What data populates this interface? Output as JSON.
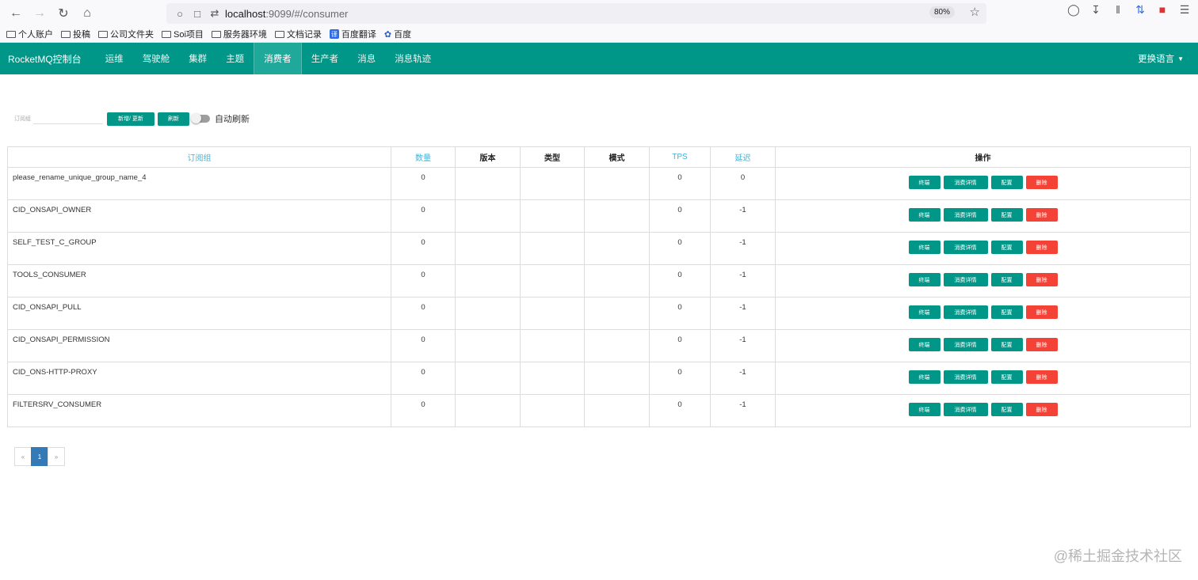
{
  "browser": {
    "url_host": "localhost",
    "url_path": ":9099/#/consumer",
    "zoom": "80%",
    "bookmarks": [
      "个人账户",
      "投稿",
      "公司文件夹",
      "Soi项目",
      "服务器环境",
      "文档记录",
      "百度翻译",
      "百度"
    ]
  },
  "navbar": {
    "brand": "RocketMQ控制台",
    "items": [
      "运维",
      "驾驶舱",
      "集群",
      "主题",
      "消费者",
      "生产者",
      "消息",
      "消息轨迹"
    ],
    "active": "消费者",
    "language": "更换语言"
  },
  "toolbar": {
    "search_label": "订阅组",
    "search_value": "",
    "add_update_label": "新增/ 更新",
    "refresh_label": "刷新",
    "auto_refresh_label": "自动刷新",
    "auto_refresh_on": false
  },
  "table": {
    "headers": [
      "订阅组",
      "数量",
      "版本",
      "类型",
      "模式",
      "TPS",
      "延迟",
      "操作"
    ],
    "sortable": [
      true,
      true,
      false,
      false,
      false,
      true,
      true,
      false
    ],
    "rows": [
      {
        "group": "please_rename_unique_group_name_4",
        "count": "0",
        "version": "",
        "type": "",
        "mode": "",
        "tps": "0",
        "delay": "0"
      },
      {
        "group": "CID_ONSAPI_OWNER",
        "count": "0",
        "version": "",
        "type": "",
        "mode": "",
        "tps": "0",
        "delay": "-1"
      },
      {
        "group": "SELF_TEST_C_GROUP",
        "count": "0",
        "version": "",
        "type": "",
        "mode": "",
        "tps": "0",
        "delay": "-1"
      },
      {
        "group": "TOOLS_CONSUMER",
        "count": "0",
        "version": "",
        "type": "",
        "mode": "",
        "tps": "0",
        "delay": "-1"
      },
      {
        "group": "CID_ONSAPI_PULL",
        "count": "0",
        "version": "",
        "type": "",
        "mode": "",
        "tps": "0",
        "delay": "-1"
      },
      {
        "group": "CID_ONSAPI_PERMISSION",
        "count": "0",
        "version": "",
        "type": "",
        "mode": "",
        "tps": "0",
        "delay": "-1"
      },
      {
        "group": "CID_ONS-HTTP-PROXY",
        "count": "0",
        "version": "",
        "type": "",
        "mode": "",
        "tps": "0",
        "delay": "-1"
      },
      {
        "group": "FILTERSRV_CONSUMER",
        "count": "0",
        "version": "",
        "type": "",
        "mode": "",
        "tps": "0",
        "delay": "-1"
      }
    ],
    "row_actions": {
      "terminal": "终端",
      "detail": "消费详情",
      "config": "配置",
      "delete": "删除"
    }
  },
  "pagination": {
    "prev": "«",
    "current": "1",
    "next": "»"
  },
  "watermark": "@稀土掘金技术社区",
  "colors": {
    "navbar": "#009688",
    "button": "#009688",
    "danger": "#f44336",
    "sortable_header": "#3cb4d8",
    "page_active": "#337ab7"
  }
}
